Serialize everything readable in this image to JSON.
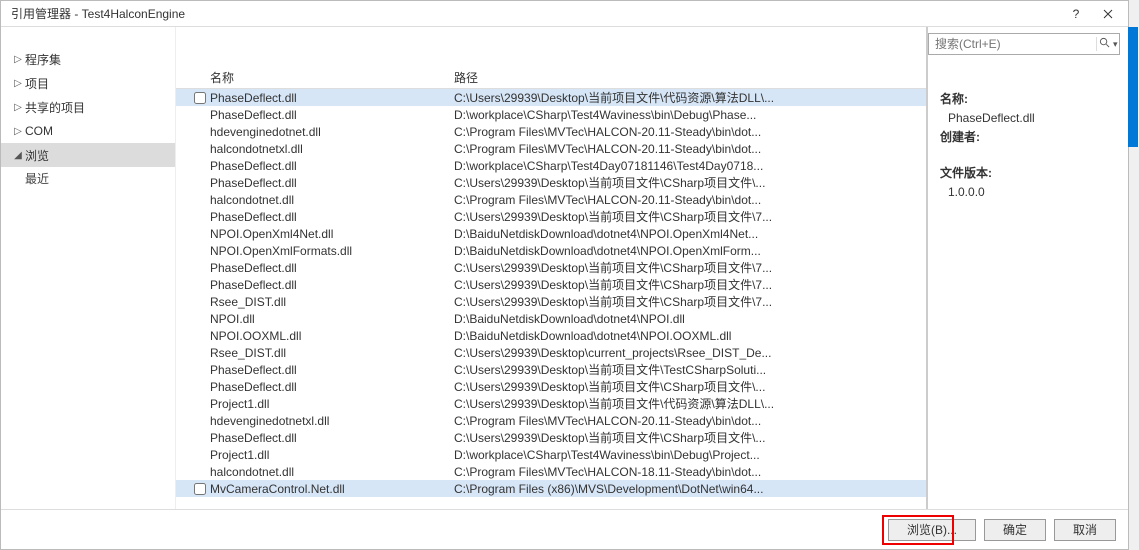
{
  "window": {
    "title": "引用管理器 - Test4HalconEngine"
  },
  "search": {
    "placeholder": "搜索(Ctrl+E)"
  },
  "sidebar": {
    "items": [
      {
        "label": "程序集",
        "expanded": false
      },
      {
        "label": "项目",
        "expanded": false
      },
      {
        "label": "共享的项目",
        "expanded": false
      },
      {
        "label": "COM",
        "expanded": false
      },
      {
        "label": "浏览",
        "expanded": true,
        "selected": true
      }
    ],
    "sub": {
      "label": "最近"
    }
  },
  "columns": {
    "name": "名称",
    "path": "路径"
  },
  "rows": [
    {
      "chk": true,
      "name": "PhaseDeflect.dll",
      "path": "C:\\Users\\29939\\Desktop\\当前项目文件\\代码资源\\算法DLL\\..."
    },
    {
      "chk": false,
      "name": "PhaseDeflect.dll",
      "path": "D:\\workplace\\CSharp\\Test4Waviness\\bin\\Debug\\Phase..."
    },
    {
      "chk": false,
      "name": "hdevenginedotnet.dll",
      "path": "C:\\Program Files\\MVTec\\HALCON-20.11-Steady\\bin\\dot..."
    },
    {
      "chk": false,
      "name": "halcondotnetxl.dll",
      "path": "C:\\Program Files\\MVTec\\HALCON-20.11-Steady\\bin\\dot..."
    },
    {
      "chk": false,
      "name": "PhaseDeflect.dll",
      "path": "D:\\workplace\\CSharp\\Test4Day07181146\\Test4Day0718..."
    },
    {
      "chk": false,
      "name": "PhaseDeflect.dll",
      "path": "C:\\Users\\29939\\Desktop\\当前项目文件\\CSharp项目文件\\..."
    },
    {
      "chk": false,
      "name": "halcondotnet.dll",
      "path": "C:\\Program Files\\MVTec\\HALCON-20.11-Steady\\bin\\dot..."
    },
    {
      "chk": false,
      "name": "PhaseDeflect.dll",
      "path": "C:\\Users\\29939\\Desktop\\当前项目文件\\CSharp项目文件\\7..."
    },
    {
      "chk": false,
      "name": "NPOI.OpenXml4Net.dll",
      "path": "D:\\BaiduNetdiskDownload\\dotnet4\\NPOI.OpenXml4Net..."
    },
    {
      "chk": false,
      "name": "NPOI.OpenXmlFormats.dll",
      "path": "D:\\BaiduNetdiskDownload\\dotnet4\\NPOI.OpenXmlForm..."
    },
    {
      "chk": false,
      "name": "PhaseDeflect.dll",
      "path": "C:\\Users\\29939\\Desktop\\当前项目文件\\CSharp项目文件\\7..."
    },
    {
      "chk": false,
      "name": "PhaseDeflect.dll",
      "path": "C:\\Users\\29939\\Desktop\\当前项目文件\\CSharp项目文件\\7..."
    },
    {
      "chk": false,
      "name": "Rsee_DIST.dll",
      "path": "C:\\Users\\29939\\Desktop\\当前项目文件\\CSharp项目文件\\7..."
    },
    {
      "chk": false,
      "name": "NPOI.dll",
      "path": "D:\\BaiduNetdiskDownload\\dotnet4\\NPOI.dll"
    },
    {
      "chk": false,
      "name": "NPOI.OOXML.dll",
      "path": "D:\\BaiduNetdiskDownload\\dotnet4\\NPOI.OOXML.dll"
    },
    {
      "chk": false,
      "name": "Rsee_DIST.dll",
      "path": "C:\\Users\\29939\\Desktop\\current_projects\\Rsee_DIST_De..."
    },
    {
      "chk": false,
      "name": "PhaseDeflect.dll",
      "path": "C:\\Users\\29939\\Desktop\\当前项目文件\\TestCSharpSoluti..."
    },
    {
      "chk": false,
      "name": "PhaseDeflect.dll",
      "path": "C:\\Users\\29939\\Desktop\\当前项目文件\\CSharp项目文件\\..."
    },
    {
      "chk": false,
      "name": "Project1.dll",
      "path": "C:\\Users\\29939\\Desktop\\当前项目文件\\代码资源\\算法DLL\\..."
    },
    {
      "chk": false,
      "name": "hdevenginedotnetxl.dll",
      "path": "C:\\Program Files\\MVTec\\HALCON-20.11-Steady\\bin\\dot..."
    },
    {
      "chk": false,
      "name": "PhaseDeflect.dll",
      "path": "C:\\Users\\29939\\Desktop\\当前项目文件\\CSharp项目文件\\..."
    },
    {
      "chk": false,
      "name": "Project1.dll",
      "path": "D:\\workplace\\CSharp\\Test4Waviness\\bin\\Debug\\Project..."
    },
    {
      "chk": false,
      "name": "halcondotnet.dll",
      "path": "C:\\Program Files\\MVTec\\HALCON-18.11-Steady\\bin\\dot..."
    },
    {
      "chk": true,
      "name": "MvCameraControl.Net.dll",
      "path": "C:\\Program Files (x86)\\MVS\\Development\\DotNet\\win64..."
    }
  ],
  "details": {
    "name_label": "名称:",
    "name_value": "PhaseDeflect.dll",
    "creator_label": "创建者:",
    "version_label": "文件版本:",
    "version_value": "1.0.0.0"
  },
  "footer": {
    "browse": "浏览(B)...",
    "ok": "确定",
    "cancel": "取消"
  }
}
